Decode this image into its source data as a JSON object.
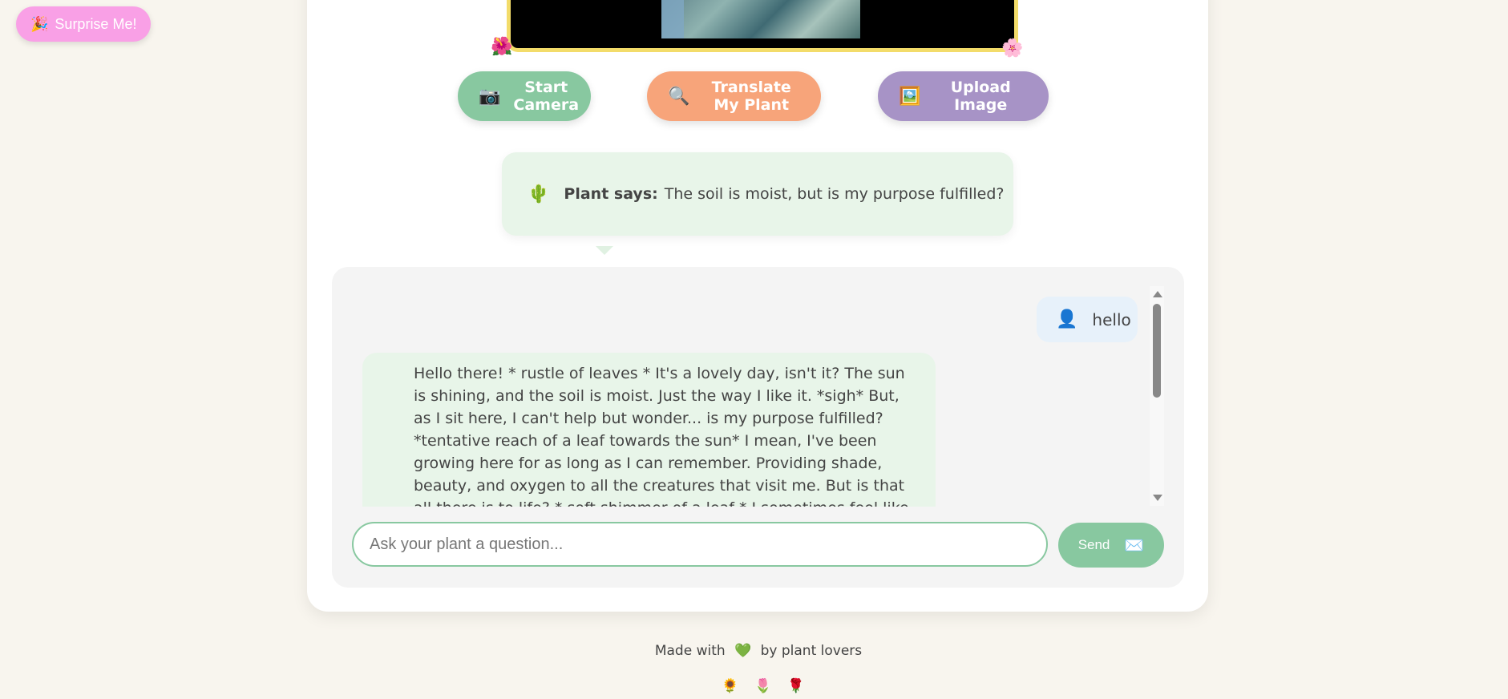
{
  "surprise": {
    "icon": "🎉",
    "label": "Surprise Me!"
  },
  "camera": {
    "flower_left": "🌺",
    "flower_right": "🌸"
  },
  "buttons": {
    "camera": {
      "icon": "📷",
      "label": "Start Camera"
    },
    "translate": {
      "icon": "🔍",
      "label": "Translate My Plant"
    },
    "upload": {
      "icon": "🖼️",
      "label": "Upload Image"
    }
  },
  "plant_says": {
    "icon": "🌵",
    "prefix": "Plant says:",
    "text": "The soil is moist, but is my purpose fulfilled?"
  },
  "chat": {
    "messages": [
      {
        "role": "user",
        "icon": "👤",
        "text": "hello"
      },
      {
        "role": "plant",
        "text": "Hello there! * rustle of leaves * It's a lovely day, isn't it? The sun is shining, and the soil is moist. Just the way I like it. *sigh* But, as I sit here, I can't help but wonder... is my purpose fulfilled? *tentative reach of a leaf towards the sun* I mean, I've been growing here for as long as I can remember. Providing shade, beauty, and oxygen to all the creatures that visit me. But is that all there is to life? * soft shimmer of a leaf * I sometimes feel like I'm"
      }
    ],
    "input_placeholder": "Ask your plant a question...",
    "input_value": "",
    "send_label": "Send",
    "send_icon": "✉️"
  },
  "footer": {
    "prefix": "Made with",
    "heart": "💚",
    "suffix": "by plant lovers",
    "flowers": [
      "🌻",
      "🌷",
      "🌹"
    ]
  }
}
